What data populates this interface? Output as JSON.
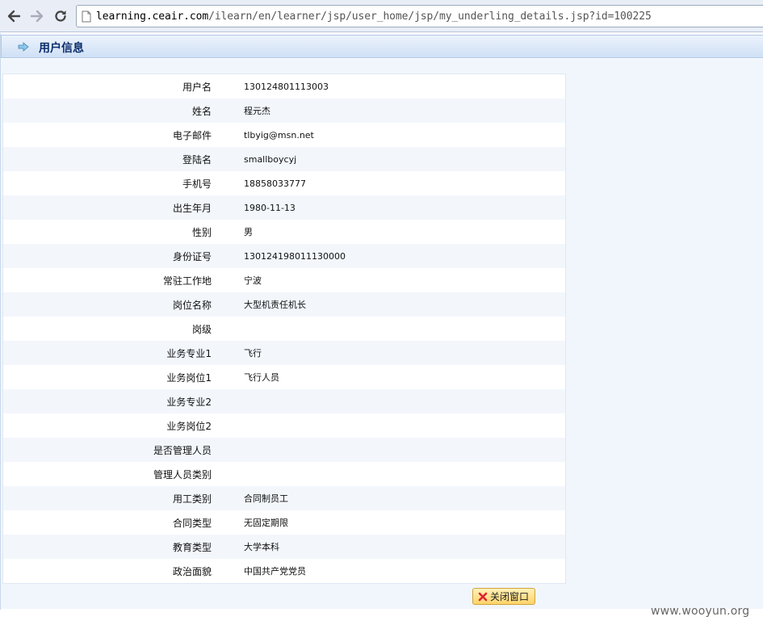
{
  "browser": {
    "url_scheme_host": "learning.ceair.com",
    "url_path": "/ilearn/en/learner/jsp/user_home/jsp/my_underling_details.jsp?id=100225"
  },
  "page": {
    "title": "用户信息",
    "close_button": "关闭窗口"
  },
  "fields": [
    {
      "label": "用户名",
      "value": "130124801113003"
    },
    {
      "label": "姓名",
      "value": "程元杰"
    },
    {
      "label": "电子邮件",
      "value": "tlbyig@msn.net"
    },
    {
      "label": "登陆名",
      "value": "smallboycyj"
    },
    {
      "label": "手机号",
      "value": "18858033777"
    },
    {
      "label": "出生年月",
      "value": "1980-11-13"
    },
    {
      "label": "性别",
      "value": "男"
    },
    {
      "label": "身份证号",
      "value": "130124198011130000"
    },
    {
      "label": "常驻工作地",
      "value": "宁波"
    },
    {
      "label": "岗位名称",
      "value": "大型机责任机长"
    },
    {
      "label": "岗级",
      "value": ""
    },
    {
      "label": "业务专业1",
      "value": "飞行"
    },
    {
      "label": "业务岗位1",
      "value": "飞行人员"
    },
    {
      "label": "业务专业2",
      "value": ""
    },
    {
      "label": "业务岗位2",
      "value": ""
    },
    {
      "label": "是否管理人员",
      "value": ""
    },
    {
      "label": "管理人员类别",
      "value": ""
    },
    {
      "label": "用工类别",
      "value": "合同制员工"
    },
    {
      "label": "合同类型",
      "value": "无固定期限"
    },
    {
      "label": "教育类型",
      "value": "大学本科"
    },
    {
      "label": "政治面貌",
      "value": "中国共产党党员"
    }
  ],
  "watermark": "www.wooyun.org",
  "icons": {
    "back": "back-arrow-icon",
    "forward": "forward-arrow-icon",
    "reload": "reload-icon",
    "page": "page-icon",
    "title": "arrow-right-icon",
    "close": "close-x-icon"
  },
  "colors": {
    "title_text": "#0c2d6b",
    "title_bar_top": "#ecf3fc",
    "title_bar_bottom": "#cfe0f6",
    "row_alt": "#f3f7fc",
    "button_bg": "#ffd36a"
  }
}
